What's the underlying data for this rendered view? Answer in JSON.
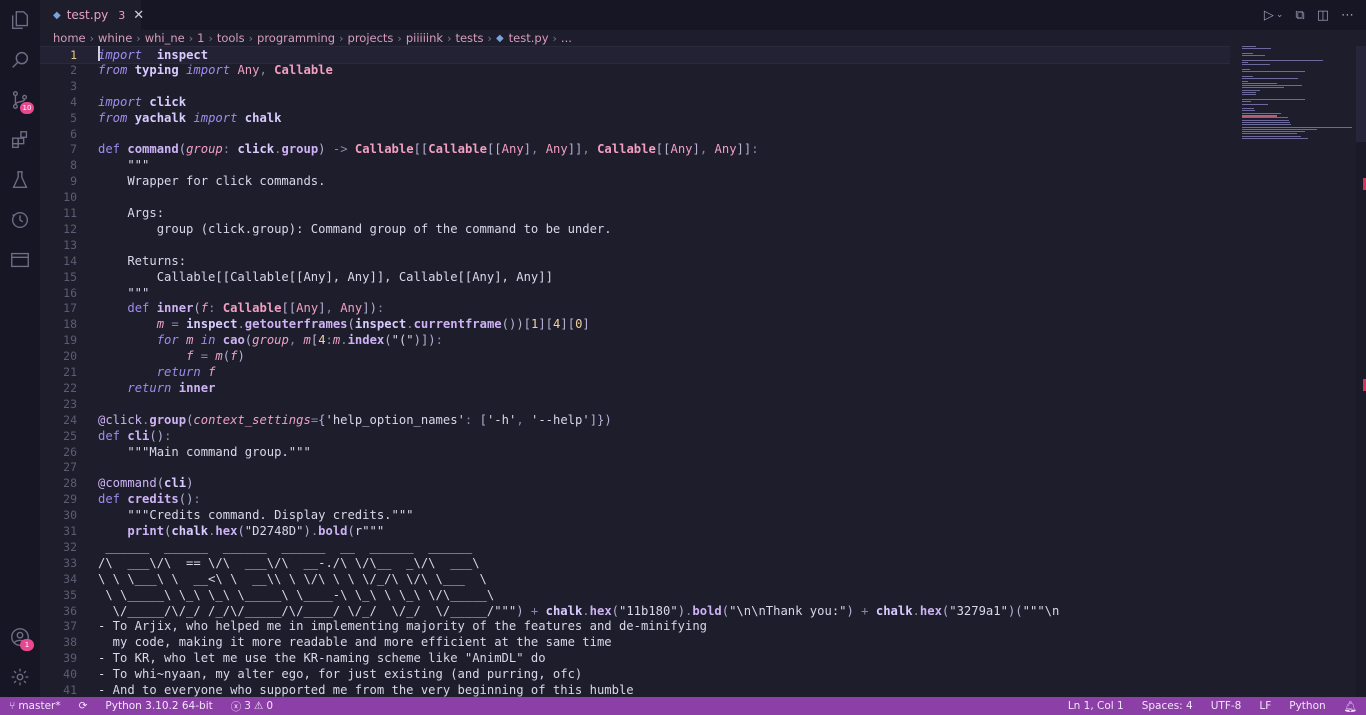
{
  "tab": {
    "name": "test.py",
    "problems": "3",
    "close_glyph": "✕"
  },
  "breadcrumb": [
    "home",
    "whine",
    "whi_ne",
    "1",
    "tools",
    "programming",
    "projects",
    "piiiiink",
    "tests",
    "test.py",
    "..."
  ],
  "activity_bar": {
    "items": [
      {
        "name": "explorer-icon"
      },
      {
        "name": "search-icon"
      },
      {
        "name": "source-control-icon",
        "badge": "10"
      },
      {
        "name": "extensions-icon"
      },
      {
        "name": "testing-icon"
      },
      {
        "name": "timeline-icon"
      },
      {
        "name": "remote-explorer-icon"
      }
    ],
    "bottom": [
      {
        "name": "account-icon",
        "badge": "1"
      },
      {
        "name": "settings-gear-icon"
      }
    ]
  },
  "editor": {
    "current_line": 1,
    "lines": [
      {
        "n": "1",
        "t": [
          [
            "kw",
            "import"
          ],
          [
            "",
            "  "
          ],
          [
            "mod",
            "inspect"
          ]
        ]
      },
      {
        "n": "2",
        "t": [
          [
            "kw",
            "from"
          ],
          [
            "",
            " "
          ],
          [
            "mod",
            "typing"
          ],
          [
            "",
            " "
          ],
          [
            "kw",
            "import"
          ],
          [
            "",
            " "
          ],
          [
            "ty",
            "Any"
          ],
          [
            "op",
            ", "
          ],
          [
            "cls",
            "Callable"
          ]
        ]
      },
      {
        "n": "3",
        "t": []
      },
      {
        "n": "4",
        "t": [
          [
            "kw",
            "import"
          ],
          [
            "",
            " "
          ],
          [
            "mod",
            "click"
          ]
        ]
      },
      {
        "n": "5",
        "t": [
          [
            "kw",
            "from"
          ],
          [
            "",
            " "
          ],
          [
            "mod",
            "yachalk"
          ],
          [
            "",
            " "
          ],
          [
            "kw",
            "import"
          ],
          [
            "",
            " "
          ],
          [
            "mod",
            "chalk"
          ]
        ]
      },
      {
        "n": "6",
        "t": []
      },
      {
        "n": "7",
        "t": [
          [
            "kd",
            "def"
          ],
          [
            "",
            " "
          ],
          [
            "fn",
            "command"
          ],
          [
            "brk",
            "("
          ],
          [
            "par",
            "group"
          ],
          [
            "op",
            ": "
          ],
          [
            "mod",
            "click"
          ],
          [
            "op",
            "."
          ],
          [
            "fn",
            "group"
          ],
          [
            "brk",
            ")"
          ],
          [
            "op",
            " -> "
          ],
          [
            "cls",
            "Callable"
          ],
          [
            "brk",
            "[["
          ],
          [
            "cls",
            "Callable"
          ],
          [
            "brk",
            "[["
          ],
          [
            "ty",
            "Any"
          ],
          [
            "brk",
            "]"
          ],
          [
            "op",
            ", "
          ],
          [
            "ty",
            "Any"
          ],
          [
            "brk",
            "]]"
          ],
          [
            "op",
            ", "
          ],
          [
            "cls",
            "Callable"
          ],
          [
            "brk",
            "[["
          ],
          [
            "ty",
            "Any"
          ],
          [
            "brk",
            "]"
          ],
          [
            "op",
            ", "
          ],
          [
            "ty",
            "Any"
          ],
          [
            "brk",
            "]]"
          ],
          [
            "op",
            ":"
          ]
        ]
      },
      {
        "n": "8",
        "t": [
          [
            "doc",
            "    \"\"\""
          ]
        ]
      },
      {
        "n": "9",
        "t": [
          [
            "doc",
            "    Wrapper for click commands."
          ]
        ]
      },
      {
        "n": "10",
        "t": []
      },
      {
        "n": "11",
        "t": [
          [
            "doc",
            "    Args:"
          ]
        ]
      },
      {
        "n": "12",
        "t": [
          [
            "doc",
            "        group (click.group): Command group of the command to be under."
          ]
        ]
      },
      {
        "n": "13",
        "t": []
      },
      {
        "n": "14",
        "t": [
          [
            "doc",
            "    Returns:"
          ]
        ]
      },
      {
        "n": "15",
        "t": [
          [
            "doc",
            "        Callable[[Callable[[Any], Any]], Callable[[Any], Any]]"
          ]
        ]
      },
      {
        "n": "16",
        "t": [
          [
            "doc",
            "    \"\"\""
          ]
        ]
      },
      {
        "n": "17",
        "t": [
          [
            "",
            " "
          ],
          [
            "kd",
            "   def"
          ],
          [
            "",
            " "
          ],
          [
            "fn",
            "inner"
          ],
          [
            "brk",
            "("
          ],
          [
            "par",
            "f"
          ],
          [
            "op",
            ": "
          ],
          [
            "cls",
            "Callable"
          ],
          [
            "brk",
            "[["
          ],
          [
            "ty",
            "Any"
          ],
          [
            "brk",
            "]"
          ],
          [
            "op",
            ", "
          ],
          [
            "ty",
            "Any"
          ],
          [
            "brk",
            "]"
          ],
          [
            "brk",
            ")"
          ],
          [
            "op",
            ":"
          ]
        ]
      },
      {
        "n": "18",
        "t": [
          [
            "",
            "        "
          ],
          [
            "par",
            "m"
          ],
          [
            "op",
            " = "
          ],
          [
            "mod",
            "inspect"
          ],
          [
            "op",
            "."
          ],
          [
            "fn",
            "getouterframes"
          ],
          [
            "brk",
            "("
          ],
          [
            "mod",
            "inspect"
          ],
          [
            "op",
            "."
          ],
          [
            "fn",
            "currentframe"
          ],
          [
            "brk",
            "())["
          ],
          [
            "num",
            "1"
          ],
          [
            "brk",
            "]["
          ],
          [
            "num",
            "4"
          ],
          [
            "brk",
            "]["
          ],
          [
            "num",
            "0"
          ],
          [
            "brk",
            "]"
          ]
        ]
      },
      {
        "n": "19",
        "t": [
          [
            "",
            "        "
          ],
          [
            "kw",
            "for"
          ],
          [
            "",
            " "
          ],
          [
            "par",
            "m"
          ],
          [
            "",
            " "
          ],
          [
            "kw",
            "in"
          ],
          [
            "",
            " "
          ],
          [
            "fn",
            "cao"
          ],
          [
            "brk",
            "("
          ],
          [
            "par",
            "group"
          ],
          [
            "op",
            ", "
          ],
          [
            "par",
            "m"
          ],
          [
            "brk",
            "["
          ],
          [
            "num",
            "4"
          ],
          [
            "op",
            ":"
          ],
          [
            "par",
            "m"
          ],
          [
            "op",
            "."
          ],
          [
            "fn",
            "index"
          ],
          [
            "brk",
            "("
          ],
          [
            "str",
            "\"(\""
          ],
          [
            "brk",
            ")])"
          ],
          [
            "op",
            ":"
          ]
        ]
      },
      {
        "n": "20",
        "t": [
          [
            "",
            "            "
          ],
          [
            "par",
            "f"
          ],
          [
            "op",
            " = "
          ],
          [
            "par",
            "m"
          ],
          [
            "brk",
            "("
          ],
          [
            "par",
            "f"
          ],
          [
            "brk",
            ")"
          ]
        ]
      },
      {
        "n": "21",
        "t": [
          [
            "",
            "        "
          ],
          [
            "kw",
            "return"
          ],
          [
            "",
            " "
          ],
          [
            "par",
            "f"
          ]
        ]
      },
      {
        "n": "22",
        "t": [
          [
            "",
            "    "
          ],
          [
            "kw",
            "return"
          ],
          [
            "",
            " "
          ],
          [
            "fn",
            "inner"
          ]
        ]
      },
      {
        "n": "23",
        "t": []
      },
      {
        "n": "24",
        "t": [
          [
            "dec",
            "@click"
          ],
          [
            "op",
            "."
          ],
          [
            "fn",
            "group"
          ],
          [
            "brk",
            "("
          ],
          [
            "par",
            "context_settings"
          ],
          [
            "op",
            "="
          ],
          [
            "brk",
            "{"
          ],
          [
            "str",
            "'help_option_names'"
          ],
          [
            "op",
            ": "
          ],
          [
            "brk",
            "["
          ],
          [
            "str",
            "'-h'"
          ],
          [
            "op",
            ", "
          ],
          [
            "str",
            "'--help'"
          ],
          [
            "brk",
            "]})"
          ]
        ]
      },
      {
        "n": "25",
        "t": [
          [
            "kd",
            "def"
          ],
          [
            "",
            " "
          ],
          [
            "fn",
            "cli"
          ],
          [
            "brk",
            "()"
          ],
          [
            "op",
            ":"
          ]
        ]
      },
      {
        "n": "26",
        "t": [
          [
            "doc",
            "    \"\"\"Main command group.\"\"\""
          ]
        ]
      },
      {
        "n": "27",
        "t": []
      },
      {
        "n": "28",
        "t": [
          [
            "dec",
            "@command"
          ],
          [
            "brk",
            "("
          ],
          [
            "mod",
            "cli"
          ],
          [
            "brk",
            ")"
          ]
        ]
      },
      {
        "n": "29",
        "t": [
          [
            "kd",
            "def"
          ],
          [
            "",
            " "
          ],
          [
            "fn",
            "credits"
          ],
          [
            "brk",
            "()"
          ],
          [
            "op",
            ":"
          ]
        ]
      },
      {
        "n": "30",
        "t": [
          [
            "doc",
            "    \"\"\"Credits command. Display credits.\"\"\""
          ]
        ]
      },
      {
        "n": "31",
        "t": [
          [
            "",
            "    "
          ],
          [
            "fn",
            "print"
          ],
          [
            "brk",
            "("
          ],
          [
            "mod",
            "chalk"
          ],
          [
            "op",
            "."
          ],
          [
            "fn",
            "hex"
          ],
          [
            "brk",
            "("
          ],
          [
            "str",
            "\"D2748D\""
          ],
          [
            "brk",
            ")"
          ],
          [
            "op",
            "."
          ],
          [
            "fn",
            "bold"
          ],
          [
            "brk",
            "("
          ],
          [
            "str",
            "r\"\"\""
          ]
        ]
      },
      {
        "n": "32",
        "t": [
          [
            "str",
            " ______  ______  ______  ______  __  ______  ______"
          ]
        ]
      },
      {
        "n": "33",
        "t": [
          [
            "str",
            "/\\  ___\\/\\  == \\/\\  ___\\/\\  __-./\\ \\/\\__  _\\/\\  ___\\"
          ]
        ]
      },
      {
        "n": "34",
        "t": [
          [
            "str",
            "\\ \\ \\___\\ \\  __<\\ \\  __\\\\ \\ \\/\\ \\ \\ \\/_/\\ \\/\\ \\___  \\"
          ]
        ]
      },
      {
        "n": "35",
        "t": [
          [
            "str",
            " \\ \\_____\\ \\_\\ \\_\\ \\_____\\ \\____-\\ \\_\\ \\ \\_\\ \\/\\_____\\"
          ]
        ]
      },
      {
        "n": "36",
        "t": [
          [
            "str",
            "  \\/_____/\\/_/ /_/\\/_____/\\/____/ \\/_/  \\/_/  \\/_____/\"\"\""
          ],
          [
            "brk",
            ")"
          ],
          [
            "op",
            " + "
          ],
          [
            "mod",
            "chalk"
          ],
          [
            "op",
            "."
          ],
          [
            "fn",
            "hex"
          ],
          [
            "brk",
            "("
          ],
          [
            "str",
            "\"11b180\""
          ],
          [
            "brk",
            ")"
          ],
          [
            "op",
            "."
          ],
          [
            "fn",
            "bold"
          ],
          [
            "brk",
            "("
          ],
          [
            "str",
            "\"\\n\\nThank you:\""
          ],
          [
            "brk",
            ")"
          ],
          [
            "op",
            " + "
          ],
          [
            "mod",
            "chalk"
          ],
          [
            "op",
            "."
          ],
          [
            "fn",
            "hex"
          ],
          [
            "brk",
            "("
          ],
          [
            "str",
            "\"3279a1\""
          ],
          [
            "brk",
            ")("
          ],
          [
            "str",
            "\"\"\"\\n"
          ]
        ]
      },
      {
        "n": "37",
        "t": [
          [
            "str",
            "- To Arjix, who helped me in implementing majority of the features and de-minifying"
          ]
        ]
      },
      {
        "n": "38",
        "t": [
          [
            "str",
            "  my code, making it more readable and more efficient at the same time"
          ]
        ]
      },
      {
        "n": "39",
        "t": [
          [
            "str",
            "- To KR, who let me use the KR-naming scheme like \"AnimDL\" do"
          ]
        ]
      },
      {
        "n": "40",
        "t": [
          [
            "str",
            "- To whi~nyaan, my alter ego, for just existing (and purring, ofc)"
          ]
        ]
      },
      {
        "n": "41",
        "t": [
          [
            "str",
            "- And to everyone who supported me from the very beginning of this humble"
          ]
        ]
      }
    ]
  },
  "status_bar": {
    "branch": "master*",
    "python": "Python 3.10.2 64-bit",
    "errors": "3",
    "warnings": "0",
    "position": "Ln 1, Col 1",
    "spaces": "Spaces: 4",
    "encoding": "UTF-8",
    "eol": "LF",
    "language": "Python"
  },
  "colors": {
    "background": "#1e1d2b",
    "status_bar": "#8d3fa8",
    "keyword": "#9f8bf0",
    "type": "#f19fc2",
    "error": "#d1365e"
  }
}
